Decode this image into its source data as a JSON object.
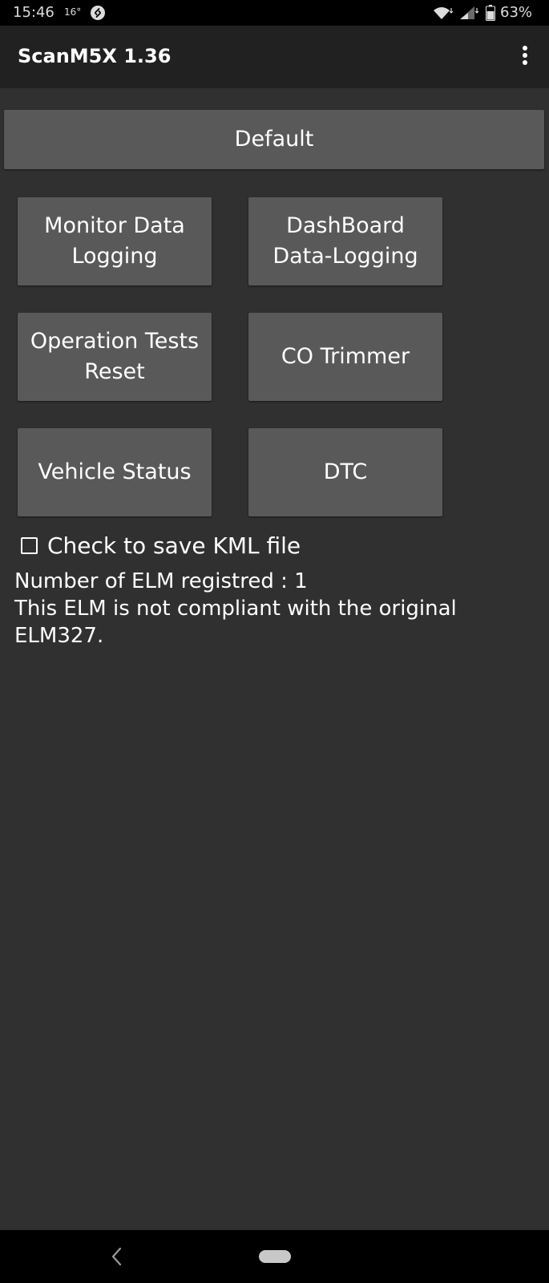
{
  "status_bar": {
    "time": "15:46",
    "temperature": "16°",
    "battery": "63%"
  },
  "app_bar": {
    "title": "ScanM5X 1.36"
  },
  "buttons": {
    "default": "Default",
    "monitor_data_logging": "Monitor Data Logging",
    "dashboard_data_logging": "DashBoard Data-Logging",
    "operation_tests_reset": "Operation Tests Reset",
    "co_trimmer": "CO Trimmer",
    "vehicle_status": "Vehicle Status",
    "dtc": "DTC"
  },
  "kml": {
    "label": "Check to save KML file",
    "checked": false
  },
  "info": {
    "line1": "Number of ELM registred : 1",
    "line2": "This ELM is not compliant with the original ELM327."
  },
  "colors": {
    "background": "#303030",
    "app_bar": "#212121",
    "button": "#595959",
    "status_bar": "#000000"
  },
  "icons": {
    "status": [
      "shazam-icon",
      "wifi-icon",
      "signal-icon",
      "battery-icon"
    ],
    "app_bar": [
      "overflow-menu-icon"
    ],
    "navigation": [
      "back-icon",
      "home-pill-icon"
    ]
  }
}
